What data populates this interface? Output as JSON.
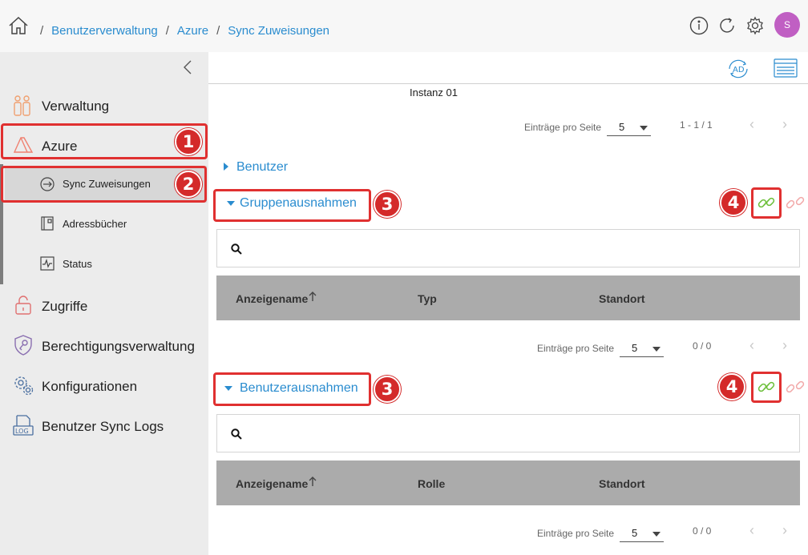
{
  "breadcrumb": {
    "items": [
      "Benutzerverwaltung",
      "Azure",
      "Sync Zuweisungen"
    ],
    "separator": "/"
  },
  "header": {
    "avatar_initial": "S"
  },
  "sidebar": {
    "items": [
      {
        "label": "Verwaltung",
        "icon": "users-icon"
      },
      {
        "label": "Azure",
        "icon": "azure-icon"
      },
      {
        "label": "Zugriffe",
        "icon": "lock-open-icon"
      },
      {
        "label": "Berechtigungsverwaltung",
        "icon": "shield-key-icon"
      },
      {
        "label": "Konfigurationen",
        "icon": "gears-icon"
      },
      {
        "label": "Benutzer Sync Logs",
        "icon": "log-icon"
      }
    ],
    "subitems": [
      {
        "label": "Sync Zuweisungen",
        "icon": "sync-arrow-icon"
      },
      {
        "label": "Adressbücher",
        "icon": "address-book-icon"
      },
      {
        "label": "Status",
        "icon": "status-pulse-icon"
      }
    ]
  },
  "main": {
    "instance_label": "Instanz 01",
    "pager_top": {
      "label": "Einträge pro Seite",
      "value": "5",
      "range": "1 - 1 / 1"
    },
    "benutzer_section": {
      "title": "Benutzer"
    },
    "gruppen_section": {
      "title": "Gruppenausnahmen",
      "columns": [
        "Anzeigename",
        "Typ",
        "Standort"
      ],
      "pager": {
        "label": "Einträge pro Seite",
        "value": "5",
        "range": "0 / 0"
      }
    },
    "benutzer_ausnahmen_section": {
      "title": "Benutzerausnahmen",
      "columns": [
        "Anzeigename",
        "Rolle",
        "Standort"
      ],
      "pager": {
        "label": "Einträge pro Seite",
        "value": "5",
        "range": "0 / 0"
      }
    }
  },
  "annotations": {
    "badge_1": "1",
    "badge_2": "2",
    "badge_3": "3",
    "badge_4": "4"
  },
  "colors": {
    "accent": "#2a8ccf",
    "annotation": "#e03030",
    "link_active": "#6cbf3a",
    "link_inactive": "#f2a9a9",
    "avatar": "#c05fc3"
  }
}
